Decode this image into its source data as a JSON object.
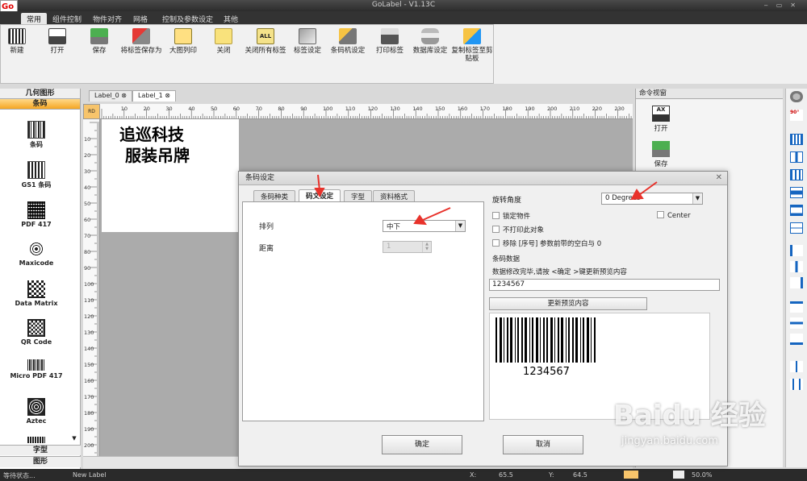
{
  "app": {
    "title": "GoLabel - V1.13C",
    "logo": "Go"
  },
  "menu": [
    "常用",
    "组件控制",
    "物件对齐",
    "网格",
    "控制及参数设定",
    "其他"
  ],
  "ribbon": [
    {
      "icon": "new-icon",
      "label": "新建"
    },
    {
      "icon": "open-icon",
      "label": "打开"
    },
    {
      "icon": "save-icon",
      "label": "保存"
    },
    {
      "icon": "save-as-icon",
      "label": "将标签保存为"
    },
    {
      "icon": "print-large-icon",
      "label": "大图列印"
    },
    {
      "icon": "close-folder-icon",
      "label": "关闭"
    },
    {
      "icon": "close-all-icon",
      "label": "关闭所有标签"
    },
    {
      "icon": "label-settings-icon",
      "label": "标签设定"
    },
    {
      "icon": "printer-settings-icon",
      "label": "条码机设定"
    },
    {
      "icon": "print-label-icon",
      "label": "打印标签"
    },
    {
      "icon": "database-icon",
      "label": "数据库设定"
    },
    {
      "icon": "copy-label-icon",
      "label": "复制标签至剪贴板"
    }
  ],
  "palette": {
    "head1": "几何图形",
    "head2": "条码",
    "items": [
      "条码",
      "GS1 条码",
      "PDF 417",
      "Maxicode",
      "Data Matrix",
      "QR Code",
      "Micro PDF 417",
      "Aztec"
    ],
    "bottom1": "字型",
    "bottom2": "图形"
  },
  "doc_tabs": [
    "Label_0",
    "Label_1"
  ],
  "ruler": {
    "corner": "RD",
    "h_ticks": [
      "10",
      "20",
      "30",
      "40",
      "50",
      "60",
      "70",
      "80",
      "90",
      "100",
      "110",
      "120",
      "130",
      "140",
      "150",
      "160",
      "170",
      "180",
      "190",
      "200",
      "210",
      "220",
      "230"
    ],
    "v_ticks": [
      "10",
      "20",
      "30",
      "40",
      "50",
      "60",
      "70",
      "80",
      "90",
      "100",
      "110",
      "120",
      "130",
      "140",
      "150",
      "160",
      "170",
      "180",
      "190",
      "200",
      "210"
    ]
  },
  "label_text": "追巡科技\n 服装吊牌",
  "command_pane": {
    "title": "命令视窗",
    "open": "打开",
    "save": "保存"
  },
  "status": {
    "left": "等待状态...",
    "doc": "New Label",
    "x_label": "X:",
    "x": "65.5",
    "y_label": "Y:",
    "y": "64.5",
    "zoom": "50.0%"
  },
  "dialog": {
    "title": "条码设定",
    "tabs": [
      "条码种类",
      "码文设定",
      "字型",
      "资料格式"
    ],
    "active_tab": 1,
    "arrange_label": "排列",
    "arrange_value": "中下",
    "distance_label": "距离",
    "distance_value": "1",
    "rotation_label": "旋转角度",
    "rotation_value": "0 Degrees",
    "lock_label": "锁定物件",
    "noprint_label": "不打印此对象",
    "remove_label": "移除 [序号] 参数前带的空白与 0",
    "center_label": "Center",
    "data_heading": "条码数据",
    "data_hint": "数据修改完毕,请按 <确定 >键更新预览内容",
    "data_value": "1234567",
    "refresh_label": "更新预览内容",
    "barcode_text": "1234567",
    "ok_label": "确定",
    "cancel_label": "取消"
  },
  "watermark": {
    "brand": "Baidu 经验",
    "url": "jingyan.baidu.com"
  },
  "colors": {
    "accent_orange": "#f5a623",
    "annotation_red": "#e8322b"
  }
}
